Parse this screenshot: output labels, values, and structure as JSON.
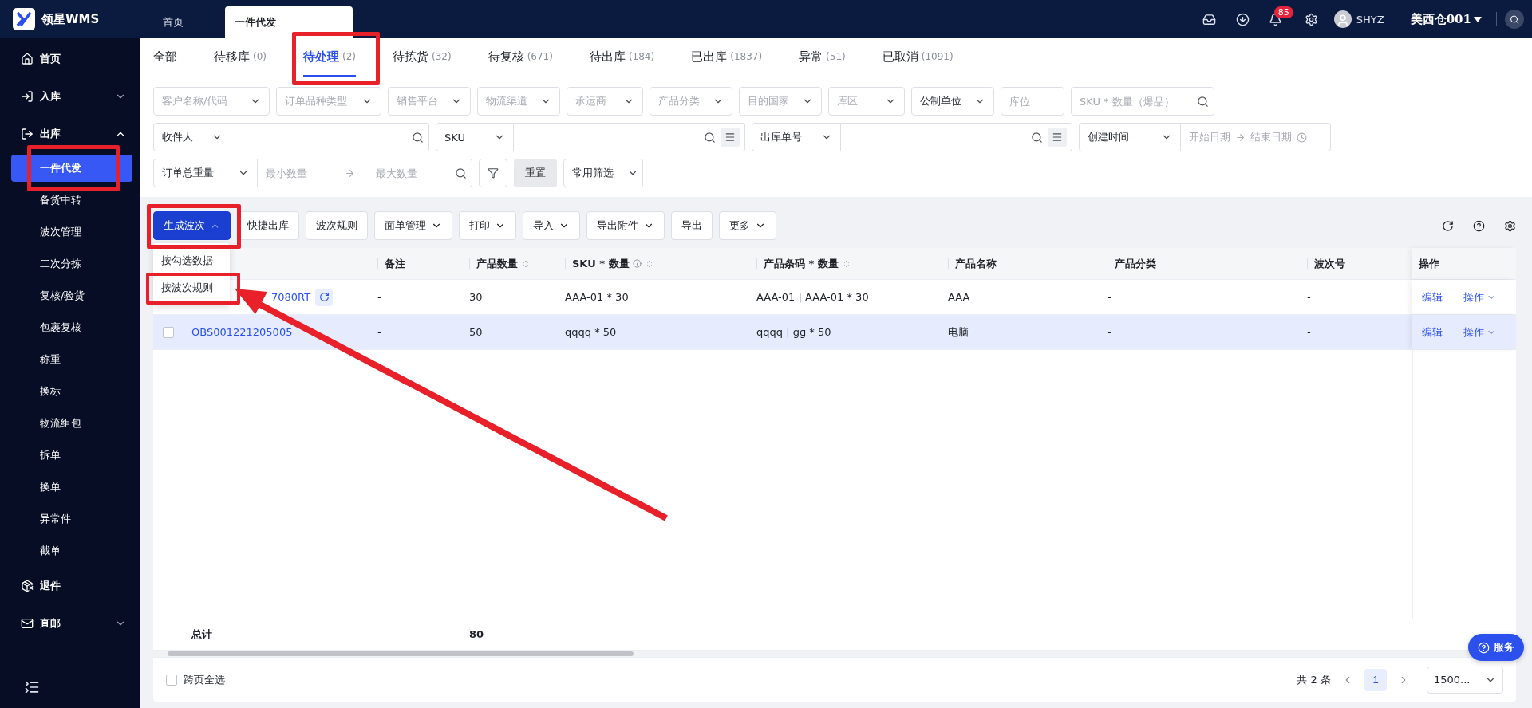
{
  "topbar": {
    "logo_text": "领星WMS",
    "tabs": [
      {
        "label": "首页",
        "selected": false
      },
      {
        "label": "一件代发",
        "selected": true
      }
    ],
    "notification_count": "85",
    "user": "SHYZ",
    "warehouse": "美西仓001"
  },
  "sidebar": {
    "items": [
      {
        "label": "首页",
        "kind": "link"
      },
      {
        "label": "入库",
        "kind": "group",
        "expanded": false
      },
      {
        "label": "出库",
        "kind": "group",
        "expanded": true,
        "children": [
          {
            "label": "一件代发",
            "selected": true
          },
          {
            "label": "备货中转",
            "selected": false
          },
          {
            "label": "波次管理",
            "selected": false
          },
          {
            "label": "二次分拣",
            "selected": false
          },
          {
            "label": "复核/验货",
            "selected": false
          },
          {
            "label": "包裹复核",
            "selected": false
          },
          {
            "label": "称重",
            "selected": false
          },
          {
            "label": "换标",
            "selected": false
          },
          {
            "label": "物流组包",
            "selected": false
          },
          {
            "label": "拆单",
            "selected": false
          },
          {
            "label": "换单",
            "selected": false
          },
          {
            "label": "异常件",
            "selected": false
          },
          {
            "label": "截单",
            "selected": false
          }
        ]
      },
      {
        "label": "退件",
        "kind": "link"
      },
      {
        "label": "直邮",
        "kind": "group",
        "expanded": false
      }
    ]
  },
  "status_tabs": [
    {
      "label": "全部",
      "selected": false
    },
    {
      "label": "待移库",
      "count": "(0)",
      "selected": false
    },
    {
      "label": "待处理",
      "count": "(2)",
      "selected": true
    },
    {
      "label": "待拣货",
      "count": "(32)",
      "selected": false
    },
    {
      "label": "待复核",
      "count": "(671)",
      "selected": false
    },
    {
      "label": "待出库",
      "count": "(184)",
      "selected": false
    },
    {
      "label": "已出库",
      "count": "(1837)",
      "selected": false
    },
    {
      "label": "异常",
      "count": "(51)",
      "selected": false
    },
    {
      "label": "已取消",
      "count": "(1091)",
      "selected": false
    }
  ],
  "filters": [
    [
      {
        "kind": "select",
        "placeholder": "客户名称/代码"
      },
      {
        "kind": "select",
        "placeholder": "订单品种类型"
      },
      {
        "kind": "select",
        "placeholder": "销售平台"
      },
      {
        "kind": "select",
        "placeholder": "物流渠道"
      },
      {
        "kind": "select",
        "placeholder": "承运商"
      },
      {
        "kind": "select",
        "placeholder": "产品分类"
      },
      {
        "kind": "select",
        "placeholder": "目的国家"
      },
      {
        "kind": "select",
        "placeholder": "库区"
      },
      {
        "kind": "select",
        "value": "公制单位"
      },
      {
        "kind": "input",
        "placeholder": "库位"
      },
      {
        "kind": "search",
        "placeholder": "SKU * 数量（爆品）"
      }
    ],
    [
      {
        "kind": "select_search",
        "select": "收件人",
        "list_button": false
      },
      {
        "kind": "select_search",
        "select": "SKU",
        "list_button": true
      },
      {
        "kind": "select_search",
        "select": "出库单号",
        "list_button": true
      },
      {
        "kind": "date_range",
        "select": "创建时间",
        "start_placeholder": "开始日期",
        "end_placeholder": "结束日期"
      }
    ],
    [
      {
        "kind": "number_range",
        "select": "订单总重量",
        "min_placeholder": "最小数量",
        "max_placeholder": "最大数量"
      },
      {
        "kind": "icon_button"
      },
      {
        "kind": "button",
        "label": "重置"
      },
      {
        "kind": "split_button",
        "label": "常用筛选"
      }
    ]
  ],
  "toolbar": {
    "buttons": [
      {
        "label": "生成波次",
        "kind": "primary",
        "open": true,
        "menu": [
          "按勾选数据",
          "按波次规则"
        ]
      },
      {
        "label": "快捷出库",
        "kind": "default",
        "dropdown": false
      },
      {
        "label": "波次规则",
        "kind": "default",
        "dropdown": false
      },
      {
        "label": "面单管理",
        "kind": "default",
        "dropdown": true
      },
      {
        "label": "打印",
        "kind": "default",
        "dropdown": true
      },
      {
        "label": "导入",
        "kind": "default",
        "dropdown": true
      },
      {
        "label": "导出附件",
        "kind": "default",
        "dropdown": true
      },
      {
        "label": "导出",
        "kind": "default",
        "dropdown": false
      },
      {
        "label": "更多",
        "kind": "default",
        "dropdown": true
      }
    ]
  },
  "table": {
    "columns": [
      {
        "label": "备注",
        "sortable": false,
        "info": false
      },
      {
        "label": "产品数量",
        "sortable": true,
        "info": false
      },
      {
        "label": "SKU * 数量",
        "sortable": true,
        "info": true
      },
      {
        "label": "产品条码 * 数量",
        "sortable": true,
        "info": false
      },
      {
        "label": "产品名称",
        "sortable": false,
        "info": false
      },
      {
        "label": "产品分类",
        "sortable": false,
        "info": false
      },
      {
        "label": "波次号",
        "sortable": false,
        "info": false
      },
      {
        "label": "操作",
        "sortable": false,
        "info": false
      }
    ],
    "rows": [
      {
        "order_no": "7080RT",
        "sync_icon": true,
        "highlighted": false,
        "cells": [
          "-",
          "30",
          "AAA-01 * 30",
          "AAA-01 | AAA-01 * 30",
          "AAA",
          "-",
          "-"
        ],
        "actions": [
          "编辑",
          "操作"
        ]
      },
      {
        "order_no": "OBS001221205005",
        "sync_icon": false,
        "highlighted": true,
        "checked": false,
        "cells": [
          "-",
          "50",
          "qqqq * 50",
          "qqqq | gg * 50",
          "电脑",
          "-",
          "-"
        ],
        "actions": [
          "编辑",
          "操作"
        ]
      }
    ],
    "total": {
      "label": "总计",
      "product_qty": "80"
    }
  },
  "footer": {
    "select_all": {
      "label": "跨页全选",
      "checked": false
    },
    "total": "共 2 条",
    "pages": [
      {
        "label": "1",
        "selected": true
      }
    ],
    "page_size": "1500..."
  },
  "service_button": "服务"
}
